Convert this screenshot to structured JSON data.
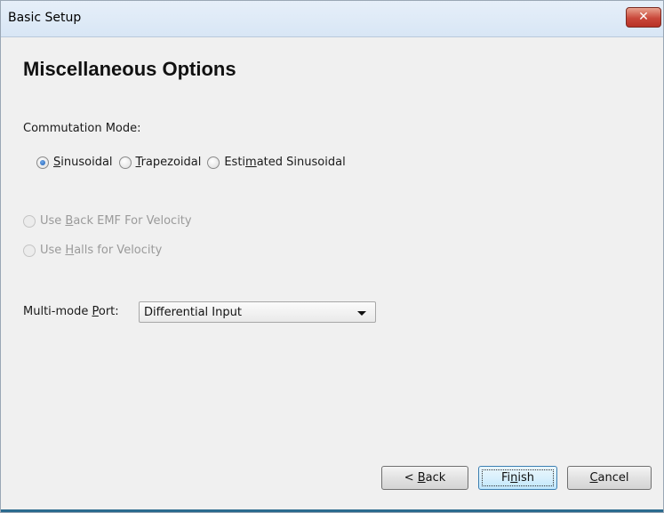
{
  "window": {
    "title": "Basic Setup",
    "close_glyph": "✕"
  },
  "page": {
    "heading": "Miscellaneous Options"
  },
  "commutation": {
    "label": "Commutation Mode:",
    "options": [
      {
        "pre": "",
        "accel": "S",
        "post": "inusoidal",
        "checked": true
      },
      {
        "pre": "",
        "accel": "T",
        "post": "rapezoidal",
        "checked": false
      },
      {
        "pre": "Esti",
        "accel": "m",
        "post": "ated Sinusoidal",
        "checked": false
      }
    ]
  },
  "velocity": {
    "back_emf": {
      "pre": "Use ",
      "accel": "B",
      "post": "ack EMF For Velocity",
      "enabled": false
    },
    "halls": {
      "pre": "Use ",
      "accel": "H",
      "post": "alls for Velocity",
      "enabled": false
    }
  },
  "multimode": {
    "label_pre": "Multi-mode ",
    "label_accel": "P",
    "label_post": "ort:",
    "selected": "Differential Input"
  },
  "buttons": {
    "back": {
      "pre": "< ",
      "accel": "B",
      "post": "ack"
    },
    "finish": {
      "pre": "Fi",
      "accel": "n",
      "post": "ish"
    },
    "cancel": {
      "pre": "",
      "accel": "C",
      "post": "ancel"
    }
  }
}
